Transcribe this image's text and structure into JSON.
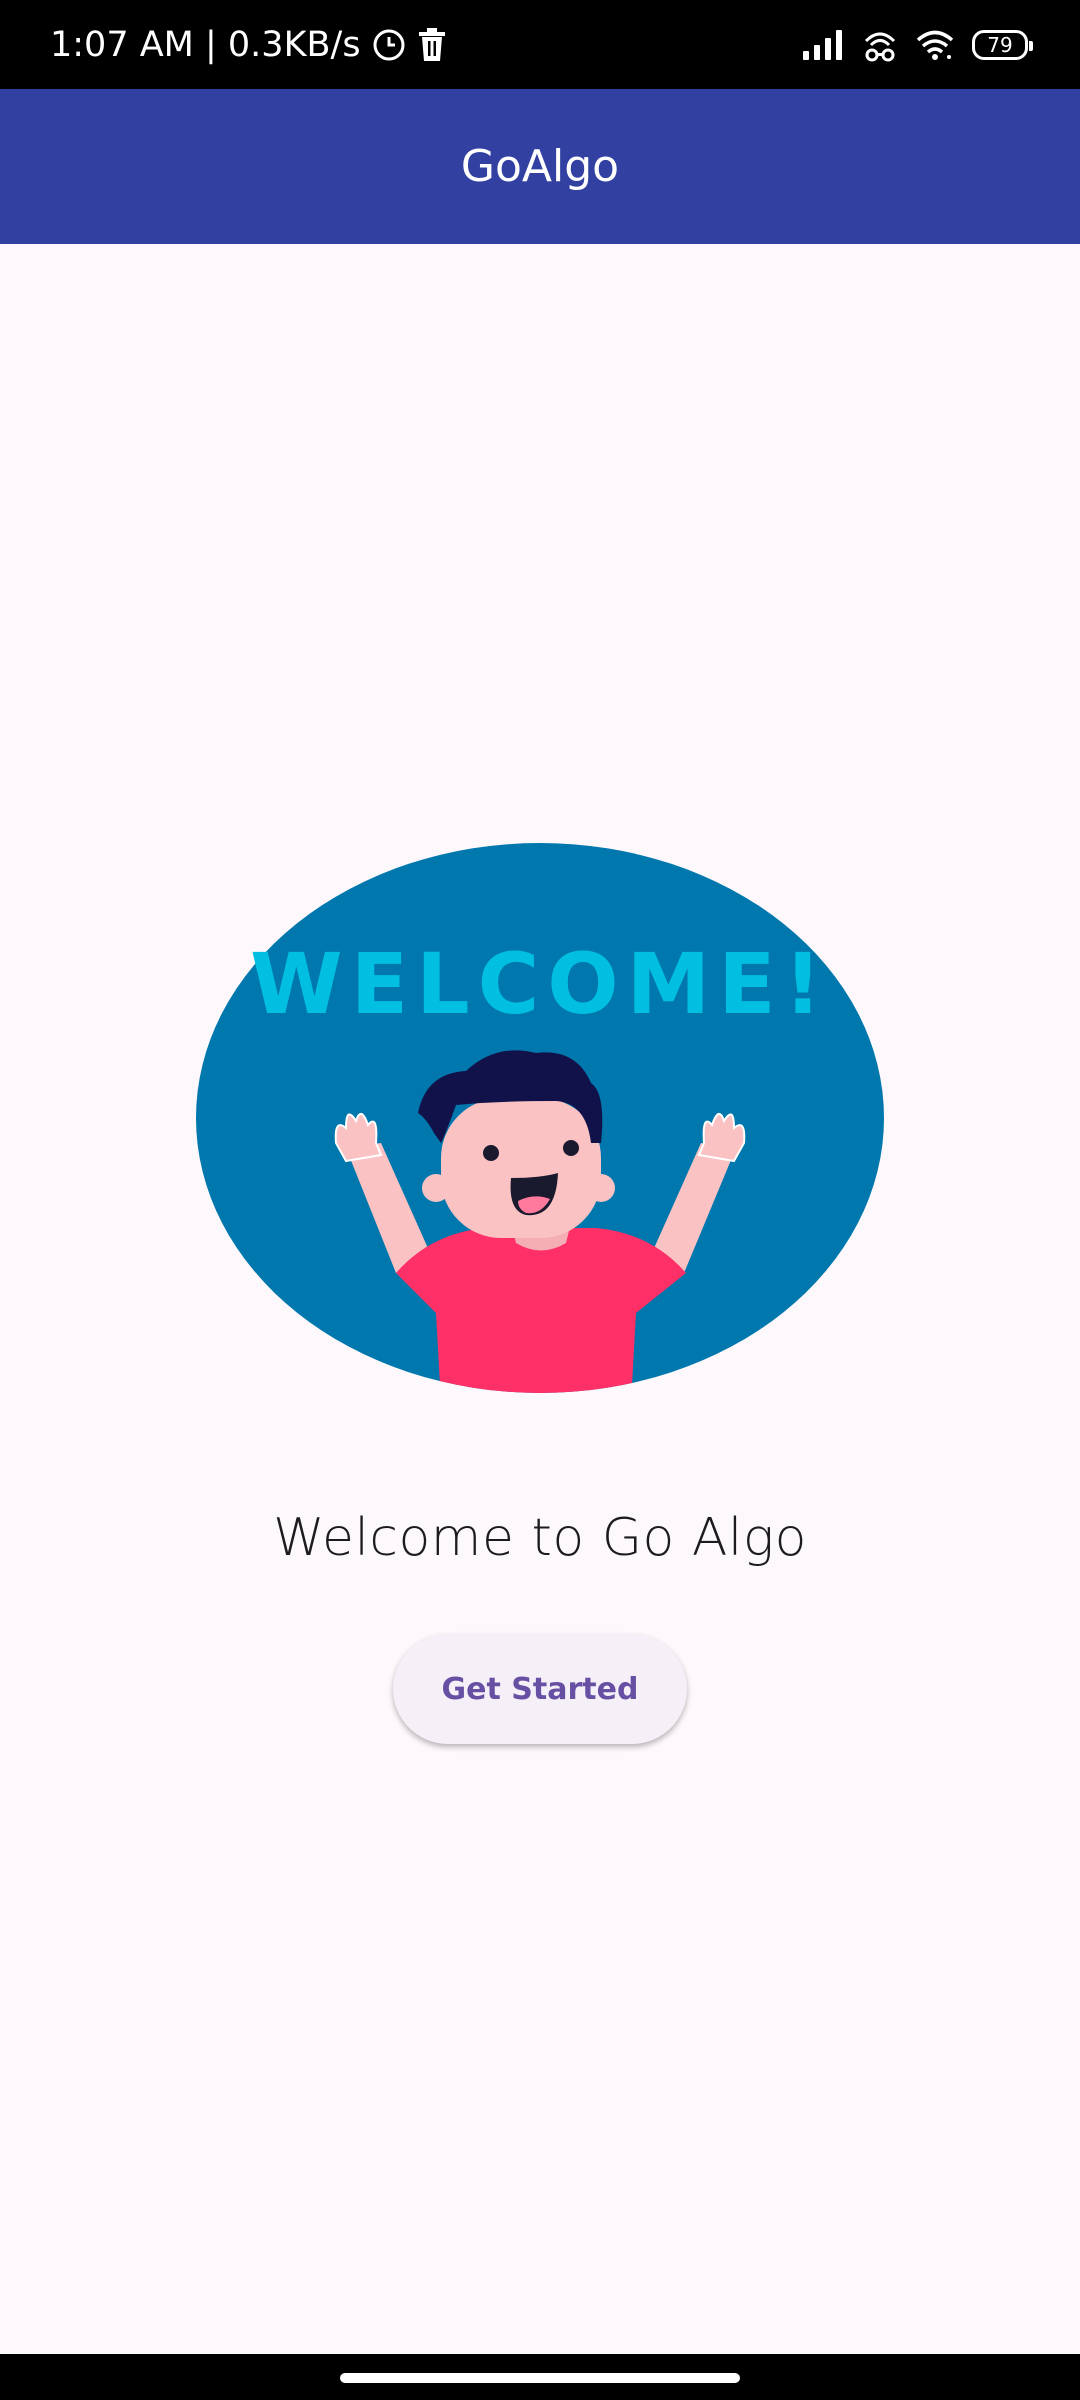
{
  "status_bar": {
    "time_and_speed": "1:07 AM | 0.3KB/s",
    "battery_level": "79",
    "icons": [
      "clock-icon",
      "trash-icon",
      "signal-icon",
      "data-icon",
      "wifi-icon",
      "battery-icon"
    ]
  },
  "app_bar": {
    "title": "GoAlgo",
    "background_color": "#3241a1"
  },
  "hero": {
    "banner_text": "WELCOME!",
    "circle_color": "#0077ad",
    "text_color": "#00bfe0"
  },
  "main": {
    "welcome_text": "Welcome to Go Algo",
    "button_label": "Get Started",
    "button_text_color": "#6750a4"
  }
}
